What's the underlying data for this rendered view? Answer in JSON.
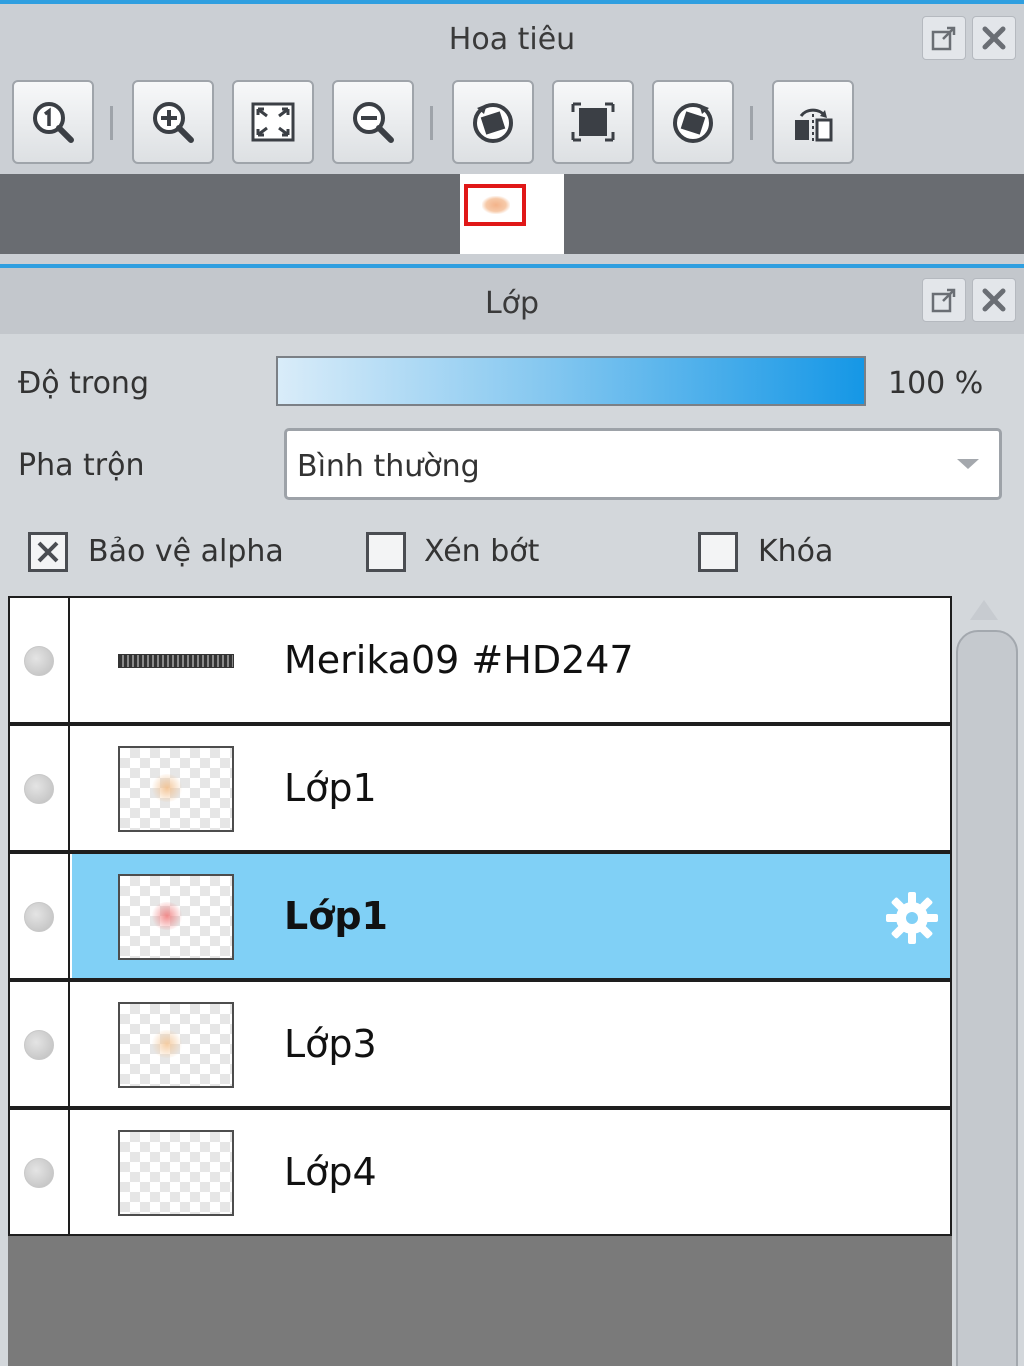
{
  "navigator": {
    "title": "Hoa tiêu",
    "tools": [
      {
        "icon": "zoom-actual-size-icon"
      },
      {
        "icon": "zoom-in-icon"
      },
      {
        "icon": "fit-to-window-icon"
      },
      {
        "icon": "zoom-out-icon"
      },
      {
        "icon": "rotate-left-icon"
      },
      {
        "icon": "reset-rotation-icon"
      },
      {
        "icon": "rotate-right-icon"
      },
      {
        "icon": "flip-horizontal-icon"
      }
    ]
  },
  "layers_panel": {
    "title": "Lớp",
    "opacity_label": "Độ trong",
    "opacity_value": "100 %",
    "opacity_fraction": 1.0,
    "blend_label": "Pha trộn",
    "blend_value": "Bình thường",
    "protect_alpha_label": "Bảo vệ alpha",
    "protect_alpha_checked": true,
    "clip_label": "Xén bớt",
    "clip_checked": false,
    "lock_label": "Khóa",
    "lock_checked": false,
    "layers": [
      {
        "name": "Merika09 #HD247",
        "kind": "text",
        "selected": false
      },
      {
        "name": "Lớp1",
        "kind": "raster",
        "selected": false,
        "thumb_color": "#f2c08e"
      },
      {
        "name": "Lớp1",
        "kind": "raster",
        "selected": true,
        "thumb_color": "#f08080"
      },
      {
        "name": "Lớp3",
        "kind": "raster",
        "selected": false,
        "thumb_color": "#f4c89a"
      },
      {
        "name": "Lớp4",
        "kind": "raster",
        "selected": false,
        "thumb_color": ""
      }
    ]
  },
  "colors": {
    "accent": "#2f9fe0",
    "selected_row": "#80d0f6",
    "preview_frame": "#e01818"
  }
}
